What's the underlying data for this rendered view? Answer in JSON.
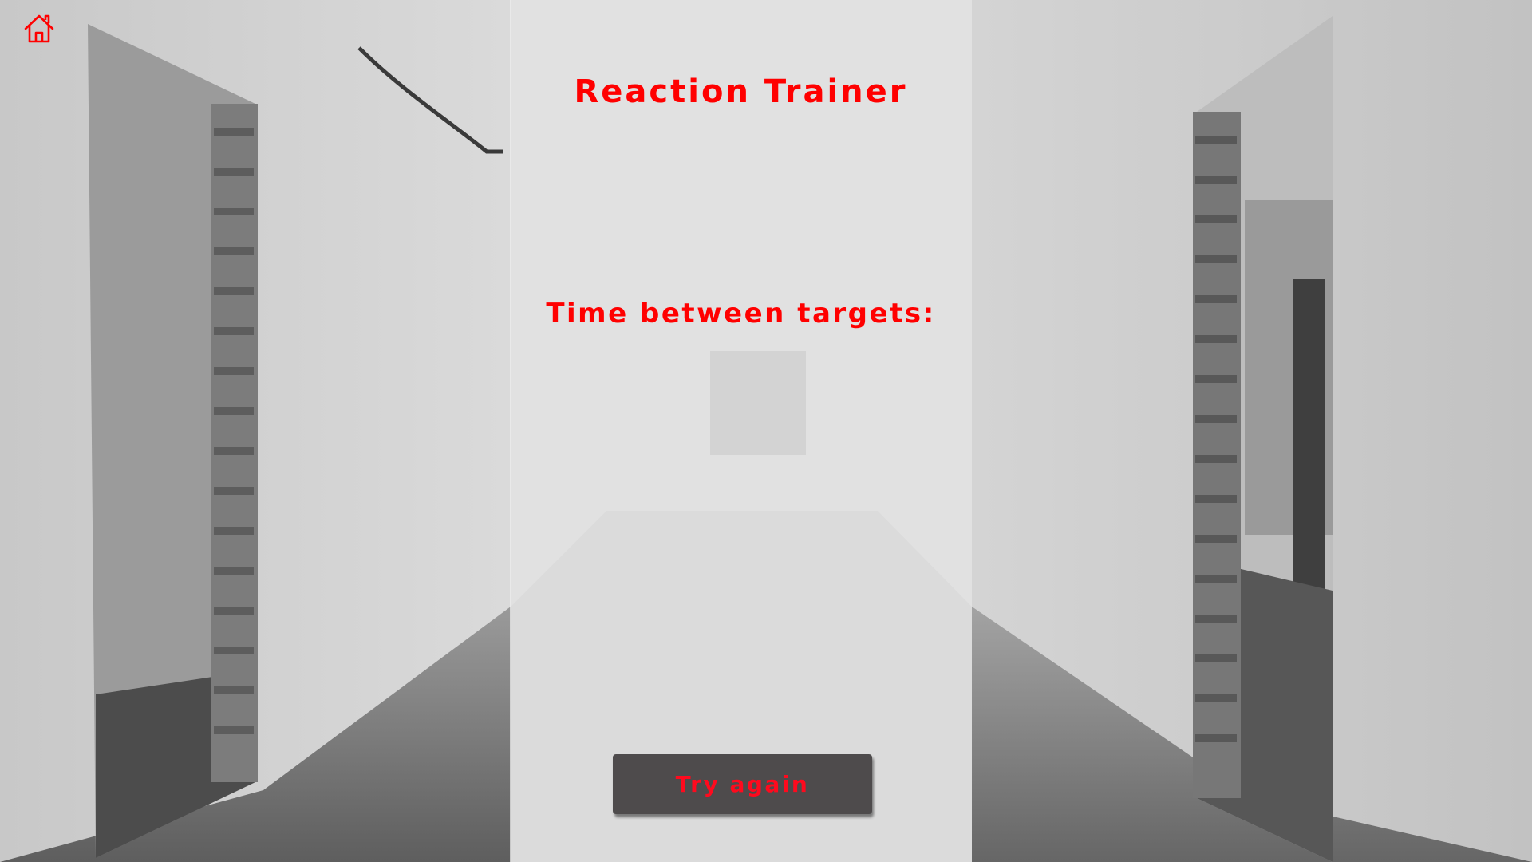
{
  "app": {
    "title": "Reaction Trainer",
    "subtitle": "Time between targets:",
    "home_icon": "home-icon"
  },
  "actions": {
    "try_again_label": "Try again"
  },
  "colors": {
    "accent": "#ff0000",
    "button_bg": "#4e4b4c",
    "panel_overlay": "#eeeeee"
  }
}
